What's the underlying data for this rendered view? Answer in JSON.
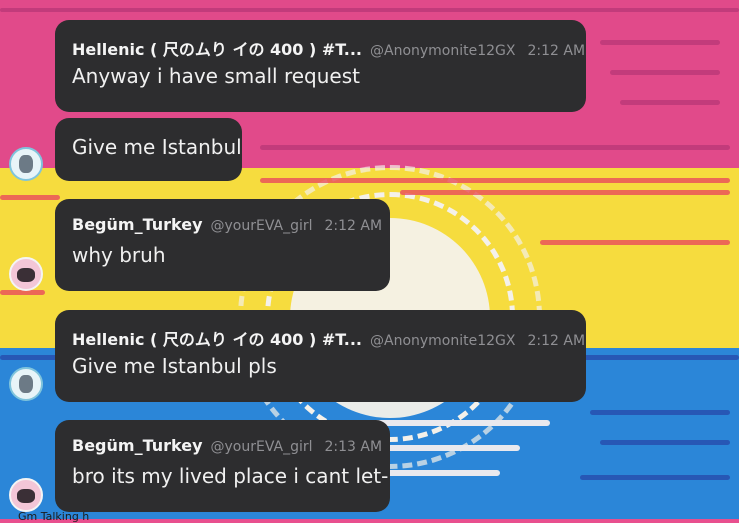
{
  "messages": [
    {
      "type": "header",
      "name": "Hellenic ( 尺のムり イの 400 ) #T...",
      "handle": "@Anonymonite12GX",
      "time": "2:12 AM",
      "text": "Anyway i have small request"
    },
    {
      "type": "solo",
      "text": "Give me Istanbul"
    },
    {
      "type": "header",
      "name": "Begüm_Turkey",
      "handle": "@yourEVA_girl",
      "time": "2:12 AM",
      "text": "why bruh"
    },
    {
      "type": "header",
      "name": "Hellenic ( 尺のムり イの 400 ) #T...",
      "handle": "@Anonymonite12GX",
      "time": "2:12 AM",
      "text": "Give me Istanbul pls"
    },
    {
      "type": "header",
      "name": "Begüm_Turkey",
      "handle": "@yourEVA_girl",
      "time": "2:13 AM",
      "text": "bro its my lived place i cant let-"
    }
  ],
  "typing_indicator": "Gm    Talking h",
  "colors": {
    "bubble": "#2d2d2f",
    "pink": "#e14a8a",
    "yellow": "#f6dc3e",
    "blue": "#2b86d8"
  }
}
